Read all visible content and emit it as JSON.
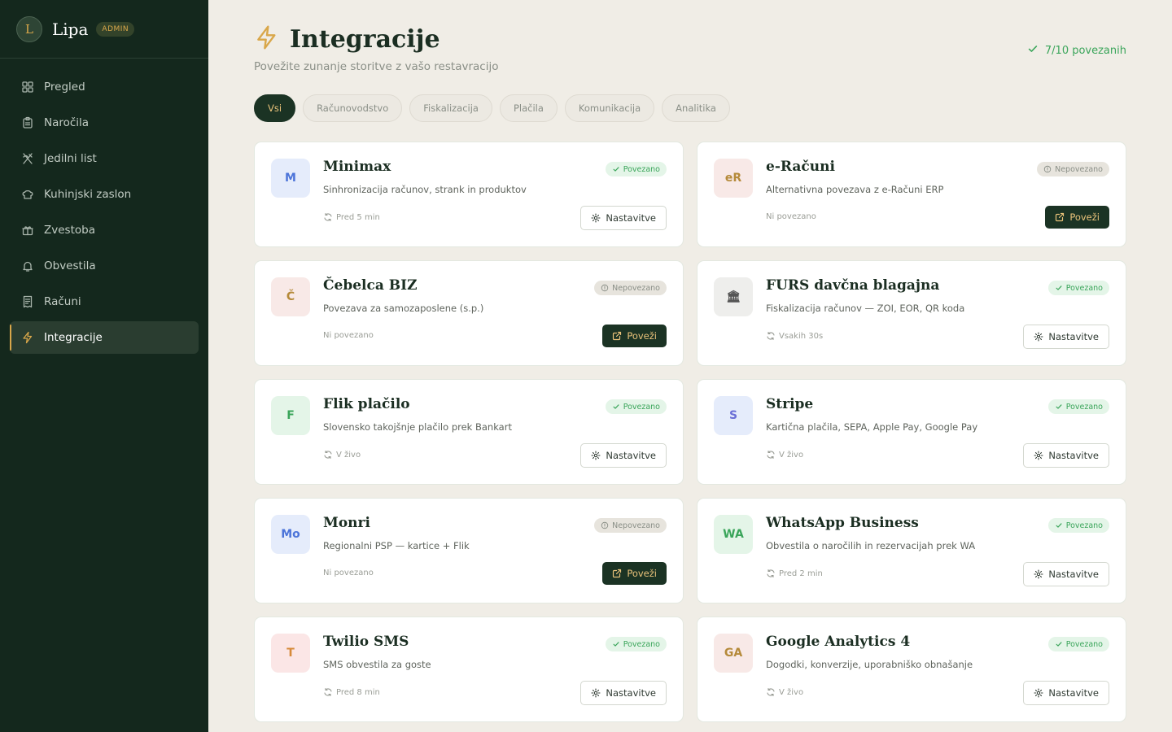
{
  "brand": {
    "initial": "L",
    "name": "Lipa",
    "badge": "ADMIN"
  },
  "nav": [
    {
      "label": "Pregled",
      "icon": "grid-icon",
      "active": false
    },
    {
      "label": "Naročila",
      "icon": "clipboard-icon",
      "active": false
    },
    {
      "label": "Jedilni list",
      "icon": "utensils-icon",
      "active": false
    },
    {
      "label": "Kuhinjski zaslon",
      "icon": "chef-hat-icon",
      "active": false
    },
    {
      "label": "Zvestoba",
      "icon": "gift-icon",
      "active": false
    },
    {
      "label": "Obvestila",
      "icon": "bell-icon",
      "active": false
    },
    {
      "label": "Računi",
      "icon": "receipt-icon",
      "active": false
    },
    {
      "label": "Integracije",
      "icon": "lightning-icon",
      "active": true
    }
  ],
  "header": {
    "title": "Integracije",
    "subtitle": "Povežite zunanje storitve z vašo restavracijo",
    "connected_count": "7/10 povezanih"
  },
  "filters": [
    {
      "label": "Vsi",
      "active": true
    },
    {
      "label": "Računovodstvo",
      "active": false
    },
    {
      "label": "Fiskalizacija",
      "active": false
    },
    {
      "label": "Plačila",
      "active": false
    },
    {
      "label": "Komunikacija",
      "active": false
    },
    {
      "label": "Analitika",
      "active": false
    }
  ],
  "labels": {
    "connected": "Povezano",
    "disconnected": "Nepovezano",
    "settings": "Nastavitve",
    "connect": "Poveži"
  },
  "integrations": [
    {
      "logo": "M",
      "logo_bg": "#e5ecfb",
      "logo_color": "#4c74d9",
      "name": "Minimax",
      "description": "Sinhronizacija računov, strank in produktov",
      "connected": true,
      "meta": "Pred 5 min"
    },
    {
      "logo": "eR",
      "logo_bg": "#f8e9e7",
      "logo_color": "#b58a3a",
      "name": "e-Računi",
      "description": "Alternativna povezava z e-Računi ERP",
      "connected": false,
      "meta": "Ni povezano"
    },
    {
      "logo": "Č",
      "logo_bg": "#f8e9e7",
      "logo_color": "#b58a3a",
      "name": "Čebelca BIZ",
      "description": "Povezava za samozaposlene (s.p.)",
      "connected": false,
      "meta": "Ni povezano"
    },
    {
      "logo": "🏛",
      "logo_bg": "#eeeeec",
      "logo_color": "#555555",
      "name": "FURS davčna blagajna",
      "description": "Fiskalizacija računov — ZOI, EOR, QR koda",
      "connected": true,
      "meta": "Vsakih 30s"
    },
    {
      "logo": "F",
      "logo_bg": "#e4f5e8",
      "logo_color": "#3aa55a",
      "name": "Flik plačilo",
      "description": "Slovensko takojšnje plačilo prek Bankart",
      "connected": true,
      "meta": "V živo"
    },
    {
      "logo": "S",
      "logo_bg": "#e5ecfb",
      "logo_color": "#6b6fd6",
      "name": "Stripe",
      "description": "Kartična plačila, SEPA, Apple Pay, Google Pay",
      "connected": true,
      "meta": "V živo"
    },
    {
      "logo": "Mo",
      "logo_bg": "#e5ecfb",
      "logo_color": "#4c74d9",
      "name": "Monri",
      "description": "Regionalni PSP — kartice + Flik",
      "connected": false,
      "meta": "Ni povezano"
    },
    {
      "logo": "WA",
      "logo_bg": "#e4f5e8",
      "logo_color": "#3aa55a",
      "name": "WhatsApp Business",
      "description": "Obvestila o naročilih in rezervacijah prek WA",
      "connected": true,
      "meta": "Pred 2 min"
    },
    {
      "logo": "T",
      "logo_bg": "#fbe6e6",
      "logo_color": "#d68a3a",
      "name": "Twilio SMS",
      "description": "SMS obvestila za goste",
      "connected": true,
      "meta": "Pred 8 min"
    },
    {
      "logo": "GA",
      "logo_bg": "#f8e9e7",
      "logo_color": "#b58a3a",
      "name": "Google Analytics 4",
      "description": "Dogodki, konverzije, uporabniško obnašanje",
      "connected": true,
      "meta": "V živo"
    }
  ],
  "colors": {
    "sidebar": "#14281d",
    "accent": "#d9a74a",
    "success": "#3aa55a",
    "background": "#f0ede6"
  }
}
